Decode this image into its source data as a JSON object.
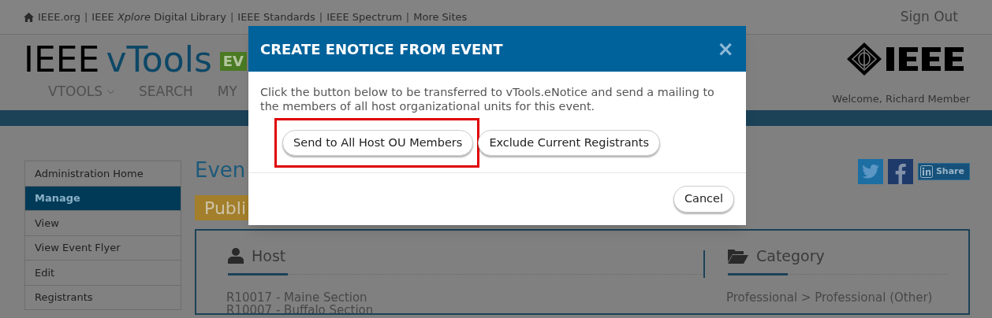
{
  "top_bar": {
    "links": [
      {
        "kind": "link",
        "text": "IEEE.org"
      },
      {
        "kind": "separator",
        "text": "|"
      },
      {
        "kind": "link",
        "text": "IEEE *Xplore* Digital Library"
      },
      {
        "kind": "separator",
        "text": "|"
      },
      {
        "kind": "link",
        "text": "IEEE Standards"
      },
      {
        "kind": "separator",
        "text": "|"
      },
      {
        "kind": "link",
        "text": "IEEE Spectrum"
      },
      {
        "kind": "separator",
        "text": "|"
      },
      {
        "kind": "link",
        "text": "More Sites"
      }
    ],
    "sign_out": "Sign Out"
  },
  "header": {
    "brand": "IEEE",
    "product": "vTools",
    "badge": "EV",
    "welcome": "Welcome, Richard Member"
  },
  "nav": [
    {
      "label": "VTOOLS",
      "dropdown": true
    },
    {
      "label": "SEARCH",
      "dropdown": false
    },
    {
      "label": "MY",
      "dropdown": false
    }
  ],
  "sidebar": {
    "items": [
      {
        "label": "Administration Home",
        "selected": false
      },
      {
        "label": "Manage",
        "selected": true
      },
      {
        "label": "View",
        "selected": false
      },
      {
        "label": "View Event Flyer",
        "selected": false
      },
      {
        "label": "Edit",
        "selected": false
      },
      {
        "label": "Registrants",
        "selected": false
      }
    ]
  },
  "event": {
    "title": "Even",
    "status": "Publi",
    "share_label": "Share"
  },
  "sections": [
    {
      "kind": "host",
      "title": "Host",
      "lines": [
        "R10017 - Maine Section",
        "R10007 - Buffalo Section"
      ]
    },
    {
      "kind": "category",
      "title": "Category",
      "lines": [
        "Professional > Professional (Other)"
      ]
    }
  ],
  "dialog": {
    "title": "CREATE ENOTICE FROM EVENT",
    "close": "×",
    "message": "Click the button below to be transferred to vTools.eNotice and send a mailing to the members of all host organizational units for this event.",
    "actions": [
      {
        "label": "Send to All Host OU Members",
        "highlighted": true
      },
      {
        "label": "Exclude Current Registrants",
        "highlighted": false
      }
    ],
    "cancel": "Cancel"
  }
}
